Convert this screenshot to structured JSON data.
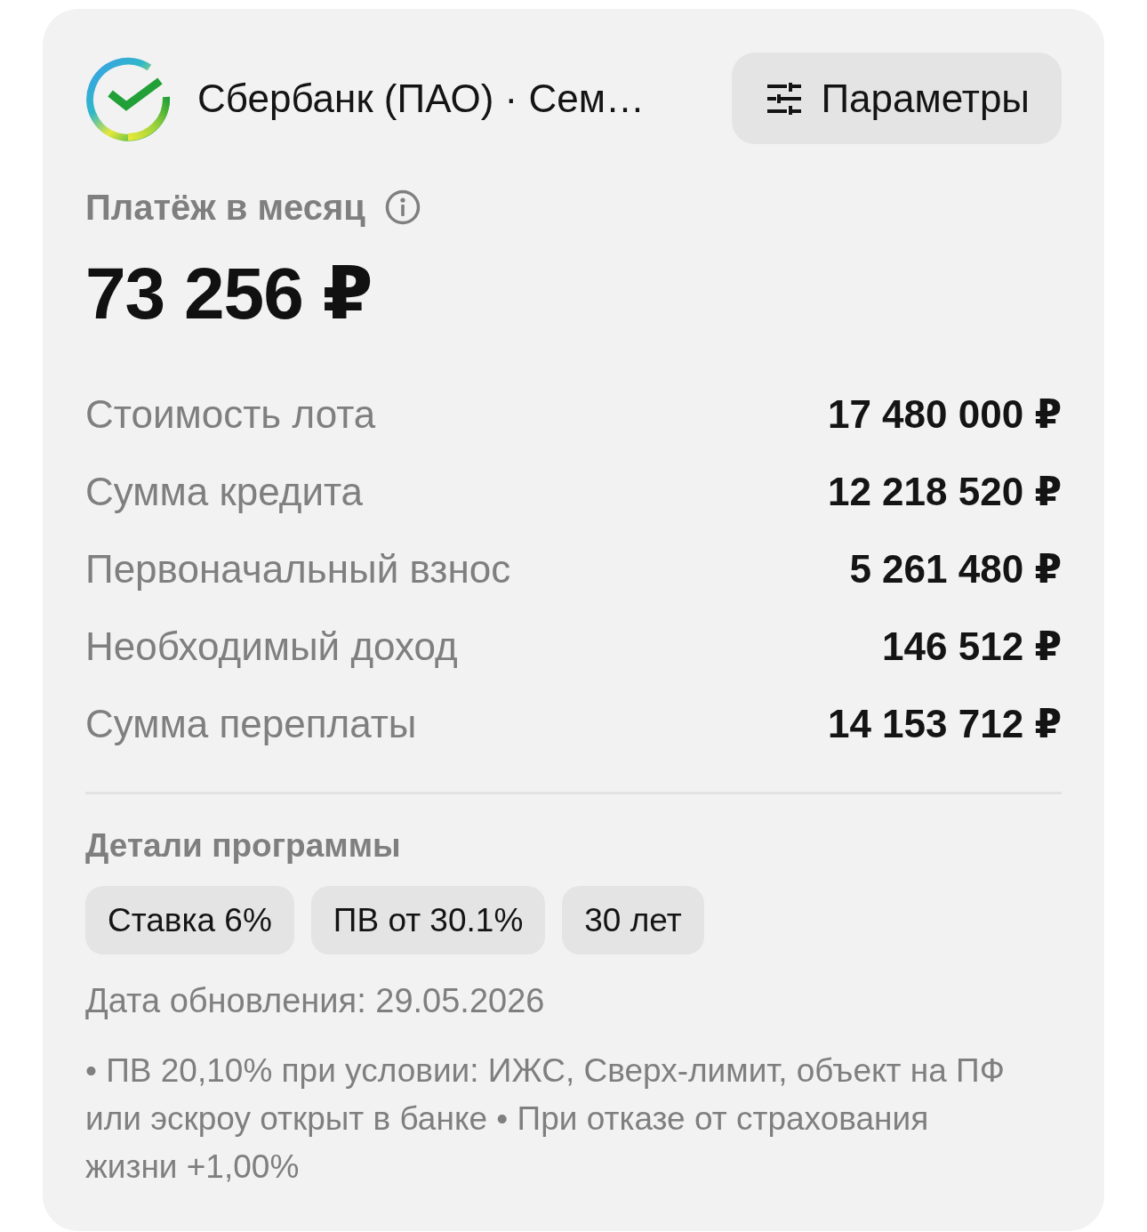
{
  "header": {
    "bank_name": "Сбербанк (ПАО) · Сем…",
    "params_button": "Параметры"
  },
  "payment": {
    "label": "Платёж в месяц",
    "amount": "73 256 ₽"
  },
  "summary": [
    {
      "label": "Стоимость лота",
      "value": "17 480 000 ₽"
    },
    {
      "label": "Сумма кредита",
      "value": "12 218 520 ₽"
    },
    {
      "label": "Первоначальный взнос",
      "value": "5 261 480 ₽"
    },
    {
      "label": "Необходимый доход",
      "value": "146 512 ₽"
    },
    {
      "label": "Сумма переплаты",
      "value": "14 153 712 ₽"
    }
  ],
  "program": {
    "title": "Детали программы",
    "tags": [
      "Ставка 6%",
      "ПВ от 30.1%",
      "30 лет"
    ],
    "updated": "Дата обновления: 29.05.2026",
    "note": "• ПВ 20,10% при условии: ИЖС, Сверх-лимит, объект на ПФ или эскроу открыт в банке • При отказе от страхования жизни +1,00%"
  }
}
